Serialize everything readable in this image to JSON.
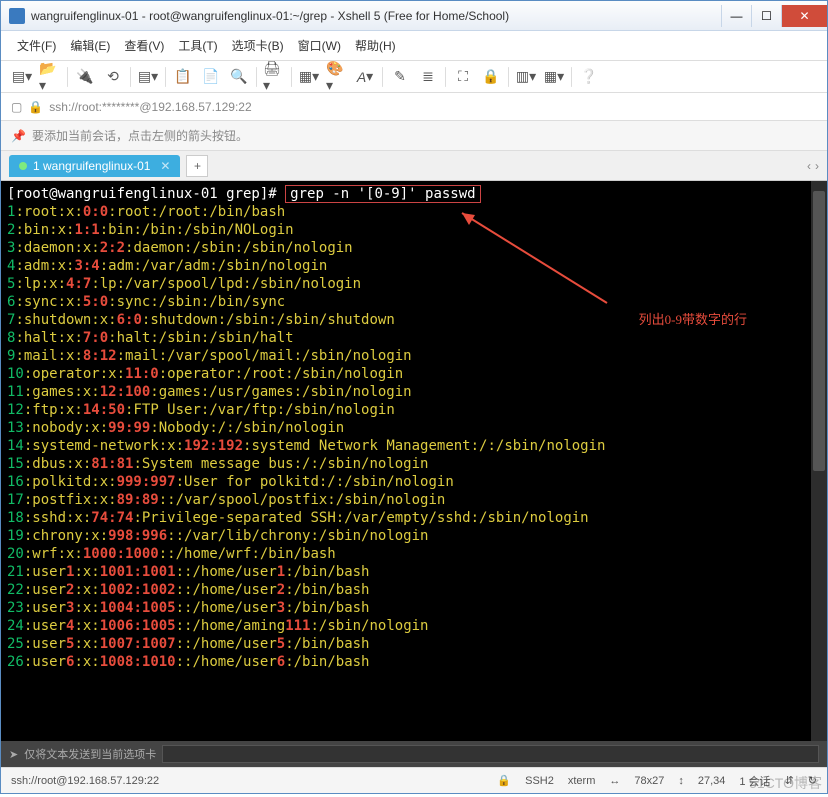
{
  "window": {
    "title": "wangruifenglinux-01 - root@wangruifenglinux-01:~/grep - Xshell 5 (Free for Home/School)"
  },
  "menubar": {
    "file": "文件(F)",
    "edit": "编辑(E)",
    "view": "查看(V)",
    "tools": "工具(T)",
    "tabs": "选项卡(B)",
    "window": "窗口(W)",
    "help": "帮助(H)"
  },
  "address": {
    "url": "ssh://root:********@192.168.57.129:22"
  },
  "hint": {
    "text": "要添加当前会话，点击左侧的箭头按钮。"
  },
  "tab": {
    "label": "1 wangruifenglinux-01"
  },
  "terminal": {
    "prompt": "[root@wangruifenglinux-01 grep]# ",
    "command": "grep -n '[0-9]' passwd",
    "annotation": "列出0-9带数字的行",
    "lines": [
      {
        "n": "1",
        "t1": ":root:x:",
        "d": "0:0",
        "t2": ":root:/root:/bin/bash",
        "mid": ""
      },
      {
        "n": "2",
        "t1": ":bin:x:",
        "d": "1:1",
        "t2": ":bin:/bin:/sbin/NOLogin",
        "mid": ""
      },
      {
        "n": "3",
        "t1": ":daemon:x:",
        "d": "2:2",
        "t2": ":daemon:/sbin:/sbin/nologin",
        "mid": ""
      },
      {
        "n": "4",
        "t1": ":adm:x:",
        "d": "3:4",
        "t2": ":adm:/var/adm:/sbin/nologin",
        "mid": ""
      },
      {
        "n": "5",
        "t1": ":lp:x:",
        "d": "4:7",
        "t2": ":lp:/var/spool/lpd:/sbin/nologin",
        "mid": ""
      },
      {
        "n": "6",
        "t1": ":sync:x:",
        "d": "5:0",
        "t2": ":sync:/sbin:/bin/sync",
        "mid": ""
      },
      {
        "n": "7",
        "t1": ":shutdown:x:",
        "d": "6:0",
        "t2": ":shutdown:/sbin:/sbin/shutdown",
        "mid": ""
      },
      {
        "n": "8",
        "t1": ":halt:x:",
        "d": "7:0",
        "t2": ":halt:/sbin:/sbin/halt",
        "mid": ""
      },
      {
        "n": "9",
        "t1": ":mail:x:",
        "d": "8:12",
        "t2": ":mail:/var/spool/mail:/sbin/nologin",
        "mid": ""
      },
      {
        "n": "10",
        "t1": ":operator:x:",
        "d": "11:0",
        "t2": ":operator:/root:/sbin/nologin",
        "mid": ""
      },
      {
        "n": "11",
        "t1": ":games:x:",
        "d": "12:100",
        "t2": ":games:/usr/games:/sbin/nologin",
        "mid": ""
      },
      {
        "n": "12",
        "t1": ":ftp:x:",
        "d": "14:50",
        "t2": ":FTP User:/var/ftp:/sbin/nologin",
        "mid": ""
      },
      {
        "n": "13",
        "t1": ":nobody:x:",
        "d": "99:99",
        "t2": ":Nobody:/:/sbin/nologin",
        "mid": ""
      },
      {
        "n": "14",
        "t1": ":systemd-network:x:",
        "d": "192:192",
        "t2": ":systemd Network Management:/:/sbin/nologin",
        "mid": ""
      },
      {
        "n": "15",
        "t1": ":dbus:x:",
        "d": "81:81",
        "t2": ":System message bus:/:/sbin/nologin",
        "mid": ""
      },
      {
        "n": "16",
        "t1": ":polkitd:x:",
        "d": "999:997",
        "t2": ":User for polkitd:/:/sbin/nologin",
        "mid": ""
      },
      {
        "n": "17",
        "t1": ":postfix:x:",
        "d": "89:89",
        "t2": "::/var/spool/postfix:/sbin/nologin",
        "mid": ""
      },
      {
        "n": "18",
        "t1": ":sshd:x:",
        "d": "74:74",
        "t2": ":Privilege-separated SSH:/var/empty/sshd:/sbin/nologin",
        "mid": ""
      },
      {
        "n": "19",
        "t1": ":chrony:x:",
        "d": "998:996",
        "t2": "::/var/lib/chrony:/sbin/nologin",
        "mid": ""
      },
      {
        "n": "20",
        "t1": ":wrf:x:",
        "d": "1000:1000",
        "t2": "::/home/wrf:/bin/bash",
        "mid": ""
      },
      {
        "n": "21",
        "t1": ":user",
        "d": "1",
        "t2": "::/home/user",
        "mid": ":x:",
        "d2": "1001:1001",
        "d3": "1",
        "t3": ":/bin/bash"
      },
      {
        "n": "22",
        "t1": ":user",
        "d": "2",
        "t2": "::/home/user",
        "mid": ":x:",
        "d2": "1002:1002",
        "d3": "2",
        "t3": ":/bin/bash"
      },
      {
        "n": "23",
        "t1": ":user",
        "d": "3",
        "t2": "::/home/user",
        "mid": ":x:",
        "d2": "1004:1005",
        "d3": "3",
        "t3": ":/bin/bash"
      },
      {
        "n": "24",
        "t1": ":user",
        "d": "4",
        "t2": "::/home/aming",
        "mid": ":x:",
        "d2": "1006:1005",
        "d3": "111",
        "t3": ":/sbin/nologin"
      },
      {
        "n": "25",
        "t1": ":user",
        "d": "5",
        "t2": "::/home/user",
        "mid": ":x:",
        "d2": "1007:1007",
        "d3": "5",
        "t3": ":/bin/bash"
      },
      {
        "n": "26",
        "t1": ":user",
        "d": "6",
        "t2": "::/home/user",
        "mid": ":x:",
        "d2": "1008:1010",
        "d3": "6",
        "t3": ":/bin/bash"
      }
    ]
  },
  "sendbar": {
    "label": "仅将文本发送到当前选项卡"
  },
  "status": {
    "conn": "ssh://root@192.168.57.129:22",
    "ssh": "SSH2",
    "term": "xterm",
    "size": "78x27",
    "cursor": "27,34",
    "sess": "1 会话"
  },
  "watermark": "51CTO博客",
  "icons": {
    "min": "—",
    "max": "☐",
    "close": "✕",
    "plus": "+",
    "left": "‹",
    "right": "›",
    "ssh_stat": "🔒",
    "updown": "⇵",
    "size_i": "↔",
    "cursor_i": "↕",
    "sess_i": "↻",
    "new": "▢"
  }
}
